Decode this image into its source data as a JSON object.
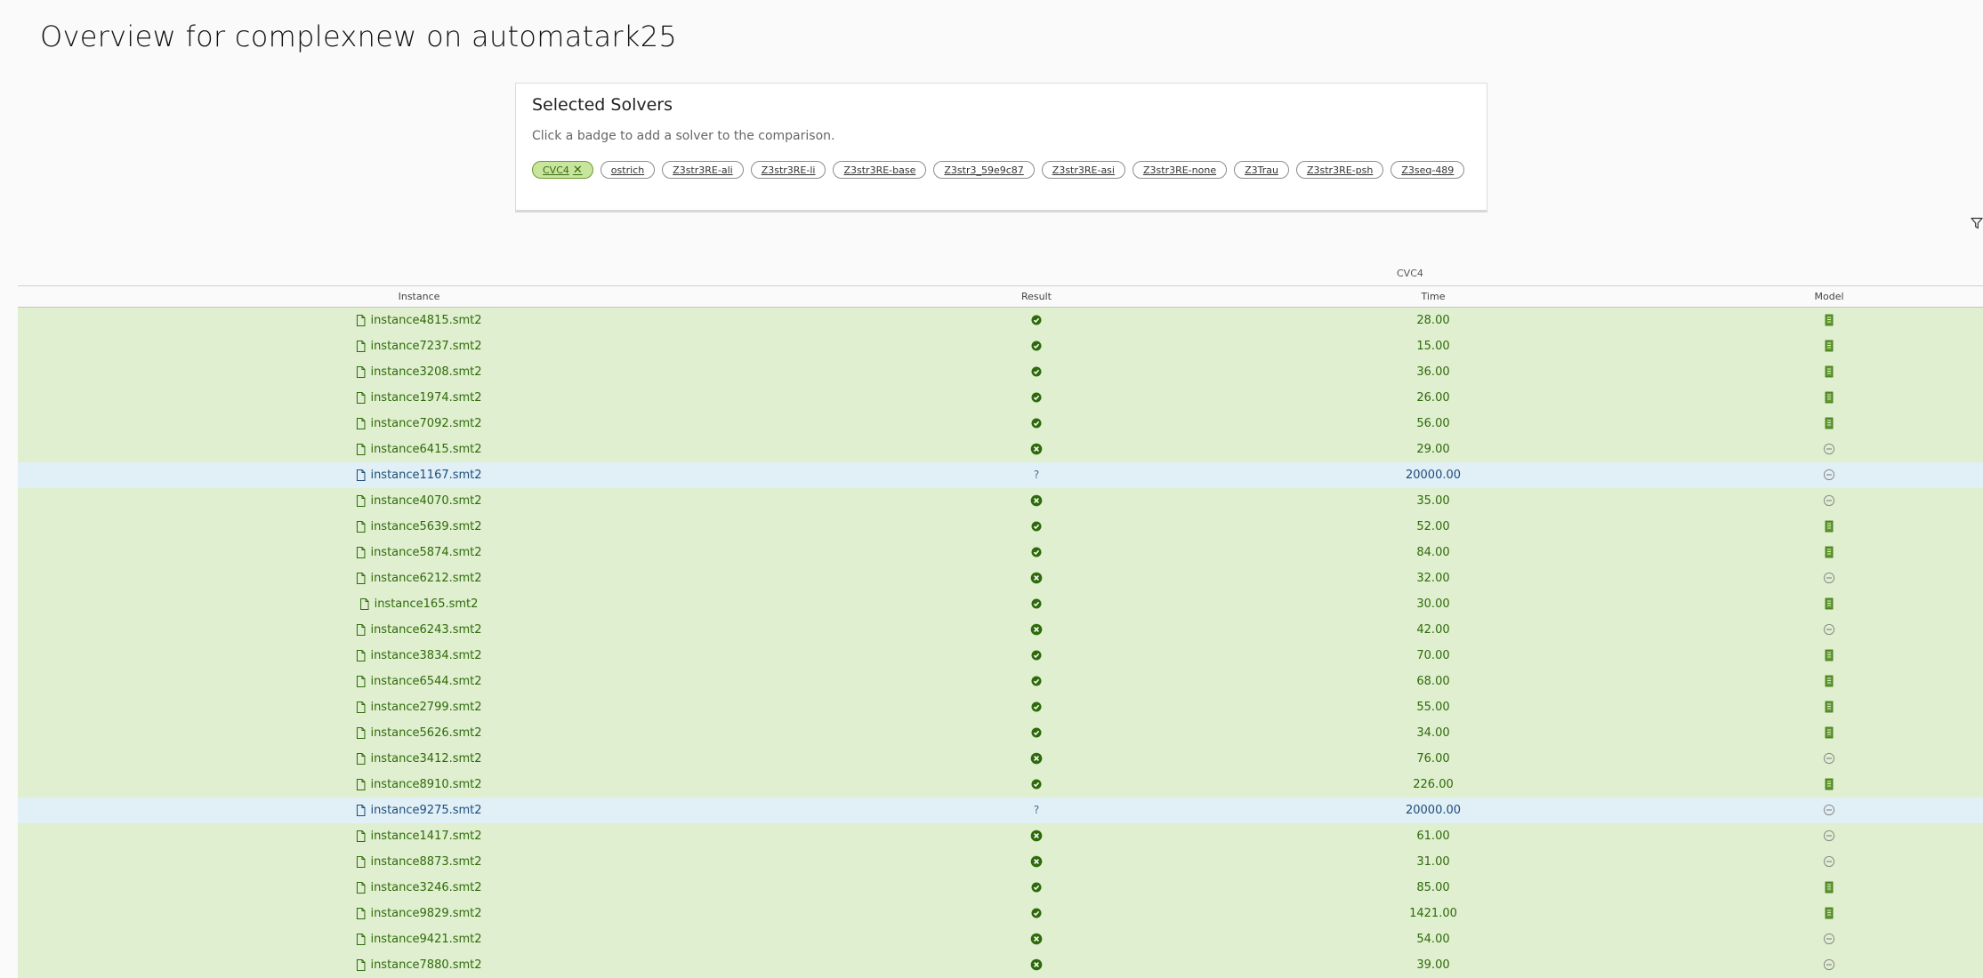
{
  "page": {
    "title": "Overview for complexnew on automatark25"
  },
  "solvers": {
    "title": "Selected Solvers",
    "hint": "Click a badge to add a solver to the comparison.",
    "badges": [
      {
        "label": "CVC4",
        "selected": true
      },
      {
        "label": "ostrich",
        "selected": false
      },
      {
        "label": "Z3str3RE-ali",
        "selected": false
      },
      {
        "label": "Z3str3RE-li",
        "selected": false
      },
      {
        "label": "Z3str3RE-base",
        "selected": false
      },
      {
        "label": "Z3str3_59e9c87",
        "selected": false
      },
      {
        "label": "Z3str3RE-asi",
        "selected": false
      },
      {
        "label": "Z3str3RE-none",
        "selected": false
      },
      {
        "label": "Z3Trau",
        "selected": false
      },
      {
        "label": "Z3str3RE-psh",
        "selected": false
      },
      {
        "label": "Z3seq-489",
        "selected": false
      }
    ]
  },
  "table": {
    "group_label": "CVC4",
    "columns": {
      "instance": "Instance",
      "result": "Result",
      "time": "Time",
      "model": "Model"
    },
    "rows": [
      {
        "instance": "instance4815.smt2",
        "result": "sat",
        "time": "28.00",
        "model": "yes"
      },
      {
        "instance": "instance7237.smt2",
        "result": "sat",
        "time": "15.00",
        "model": "yes"
      },
      {
        "instance": "instance3208.smt2",
        "result": "sat",
        "time": "36.00",
        "model": "yes"
      },
      {
        "instance": "instance1974.smt2",
        "result": "sat",
        "time": "26.00",
        "model": "yes"
      },
      {
        "instance": "instance7092.smt2",
        "result": "sat",
        "time": "56.00",
        "model": "yes"
      },
      {
        "instance": "instance6415.smt2",
        "result": "unsat",
        "time": "29.00",
        "model": "none"
      },
      {
        "instance": "instance1167.smt2",
        "result": "unknown",
        "time": "20000.00",
        "model": "none"
      },
      {
        "instance": "instance4070.smt2",
        "result": "unsat",
        "time": "35.00",
        "model": "none"
      },
      {
        "instance": "instance5639.smt2",
        "result": "sat",
        "time": "52.00",
        "model": "yes"
      },
      {
        "instance": "instance5874.smt2",
        "result": "sat",
        "time": "84.00",
        "model": "yes"
      },
      {
        "instance": "instance6212.smt2",
        "result": "unsat",
        "time": "32.00",
        "model": "none"
      },
      {
        "instance": "instance165.smt2",
        "result": "sat",
        "time": "30.00",
        "model": "yes"
      },
      {
        "instance": "instance6243.smt2",
        "result": "unsat",
        "time": "42.00",
        "model": "none"
      },
      {
        "instance": "instance3834.smt2",
        "result": "sat",
        "time": "70.00",
        "model": "yes"
      },
      {
        "instance": "instance6544.smt2",
        "result": "sat",
        "time": "68.00",
        "model": "yes"
      },
      {
        "instance": "instance2799.smt2",
        "result": "sat",
        "time": "55.00",
        "model": "yes"
      },
      {
        "instance": "instance5626.smt2",
        "result": "sat",
        "time": "34.00",
        "model": "yes"
      },
      {
        "instance": "instance3412.smt2",
        "result": "unsat",
        "time": "76.00",
        "model": "none"
      },
      {
        "instance": "instance8910.smt2",
        "result": "sat",
        "time": "226.00",
        "model": "yes"
      },
      {
        "instance": "instance9275.smt2",
        "result": "unknown",
        "time": "20000.00",
        "model": "none"
      },
      {
        "instance": "instance1417.smt2",
        "result": "unsat",
        "time": "61.00",
        "model": "none"
      },
      {
        "instance": "instance8873.smt2",
        "result": "unsat",
        "time": "31.00",
        "model": "none"
      },
      {
        "instance": "instance3246.smt2",
        "result": "sat",
        "time": "85.00",
        "model": "yes"
      },
      {
        "instance": "instance9829.smt2",
        "result": "sat",
        "time": "1421.00",
        "model": "yes"
      },
      {
        "instance": "instance9421.smt2",
        "result": "unsat",
        "time": "54.00",
        "model": "none"
      },
      {
        "instance": "instance7880.smt2",
        "result": "unsat",
        "time": "39.00",
        "model": "none"
      }
    ]
  },
  "colors": {
    "row_green": "#dfefcf",
    "row_blue": "#e1eff7",
    "badge_selected": "#c7e59c",
    "icon_green": "#2d6a0a"
  }
}
